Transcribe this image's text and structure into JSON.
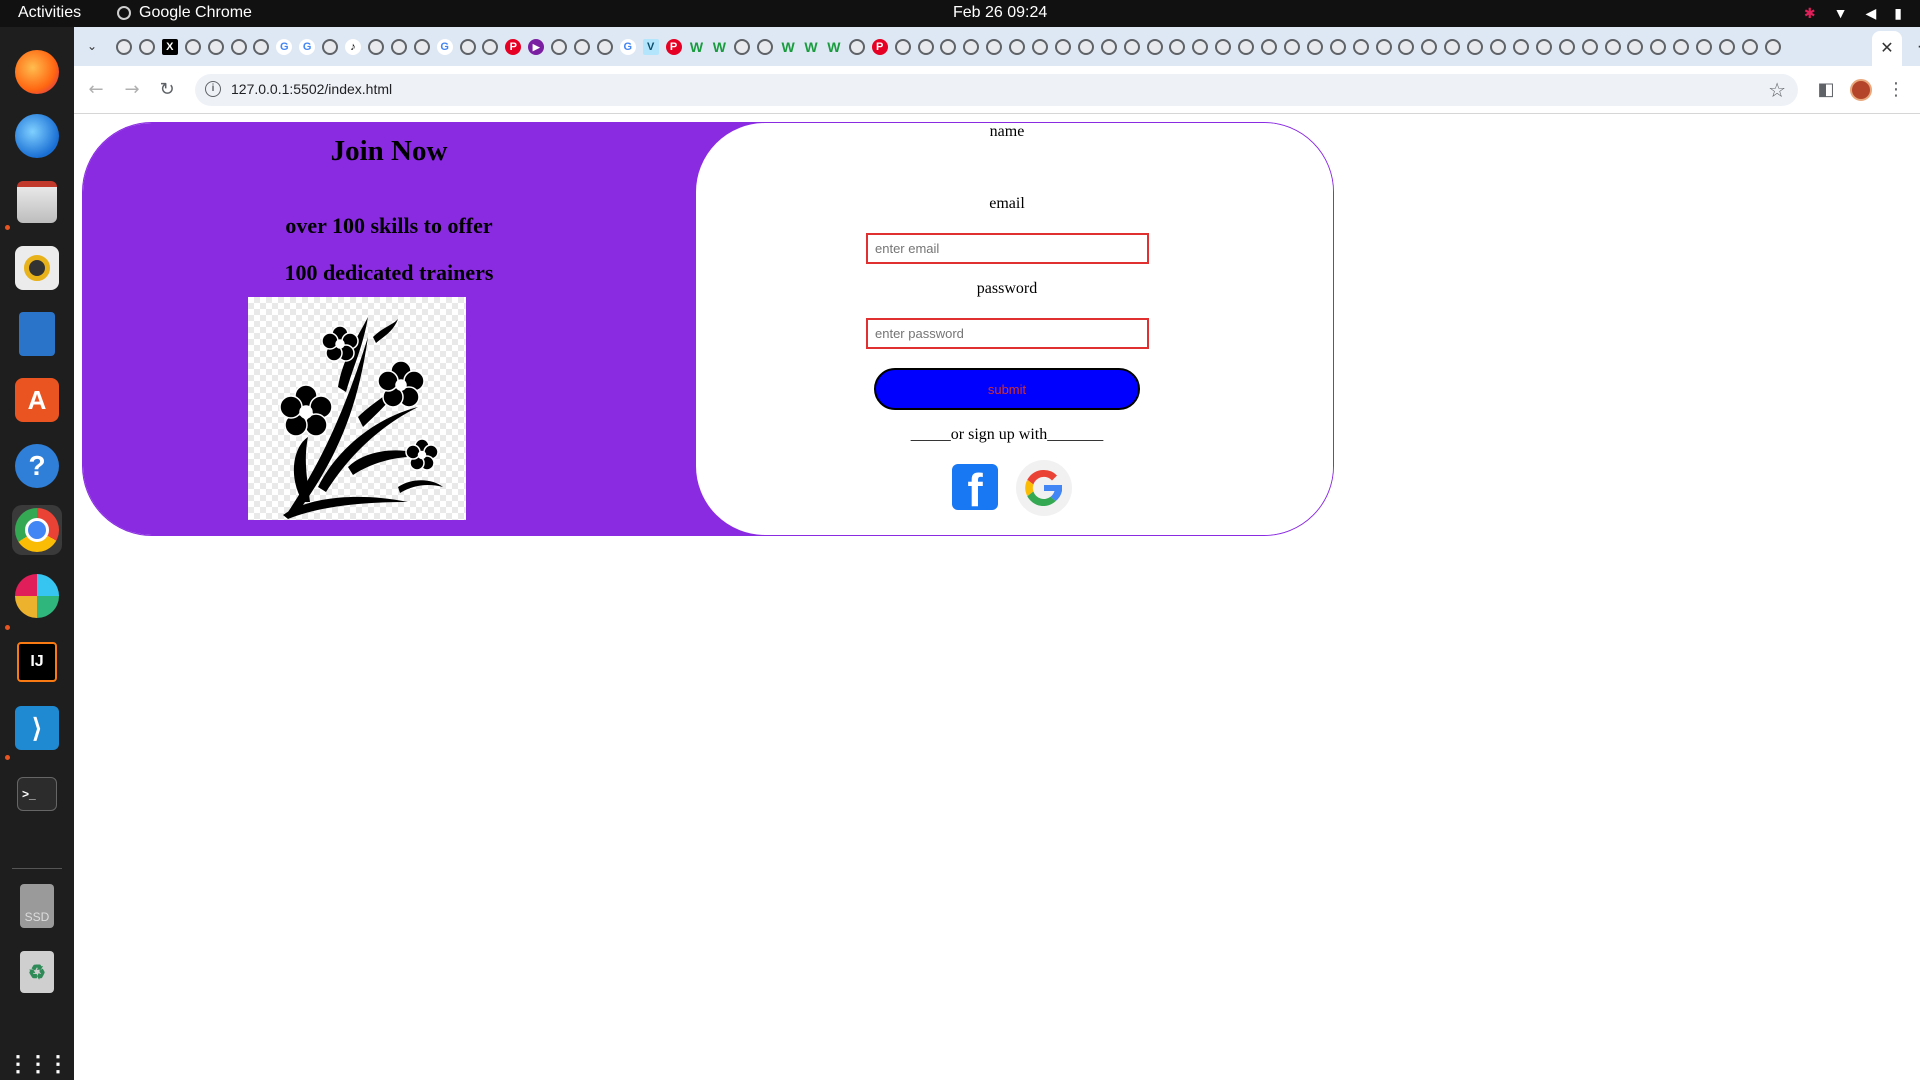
{
  "topbar": {
    "activities": "Activities",
    "app_name": "Google Chrome",
    "clock": "Feb 26  09:24"
  },
  "dock": {
    "apps": [
      "firefox",
      "thunderbird",
      "files",
      "rhythmbox",
      "writer",
      "app-center",
      "help",
      "chrome",
      "slack",
      "intellij",
      "vscode",
      "terminal",
      "ssd",
      "trash",
      "show-apps"
    ]
  },
  "browser": {
    "url": "127.0.0.1:5502/index.html",
    "tab_favicons": [
      "globe",
      "globe",
      "x",
      "globe",
      "globe",
      "globe",
      "globe",
      "g",
      "g",
      "globe",
      "tiktok",
      "globe",
      "globe",
      "globe",
      "g",
      "globe",
      "globe",
      "pinterest",
      "play",
      "globe",
      "globe",
      "globe",
      "g",
      "v",
      "pinterest",
      "w",
      "w",
      "globe",
      "globe",
      "w",
      "w",
      "w",
      "globe",
      "pinterest",
      "globe",
      "globe",
      "globe",
      "globe",
      "globe",
      "globe",
      "globe",
      "globe",
      "globe",
      "globe",
      "globe",
      "globe",
      "globe",
      "globe",
      "globe",
      "globe",
      "globe",
      "globe",
      "globe",
      "globe",
      "globe",
      "globe",
      "globe",
      "globe",
      "globe",
      "globe",
      "globe",
      "globe",
      "globe",
      "globe",
      "globe",
      "globe",
      "globe",
      "globe",
      "globe",
      "globe",
      "globe",
      "globe",
      "globe"
    ]
  },
  "page": {
    "left": {
      "heading": "Join Now",
      "line1": "over 100 skills to offer",
      "line2": "100 dedicated trainers"
    },
    "form": {
      "name_label": "name",
      "email_label": "email",
      "email_placeholder": "enter email",
      "password_label": "password",
      "password_placeholder": "enter password",
      "submit_label": "submit",
      "divider": "_____or sign up with_______"
    },
    "colors": {
      "panel": "#8a2be2",
      "submit_bg": "#0000ff",
      "submit_text": "#d03030",
      "input_border": "#e03030"
    }
  }
}
